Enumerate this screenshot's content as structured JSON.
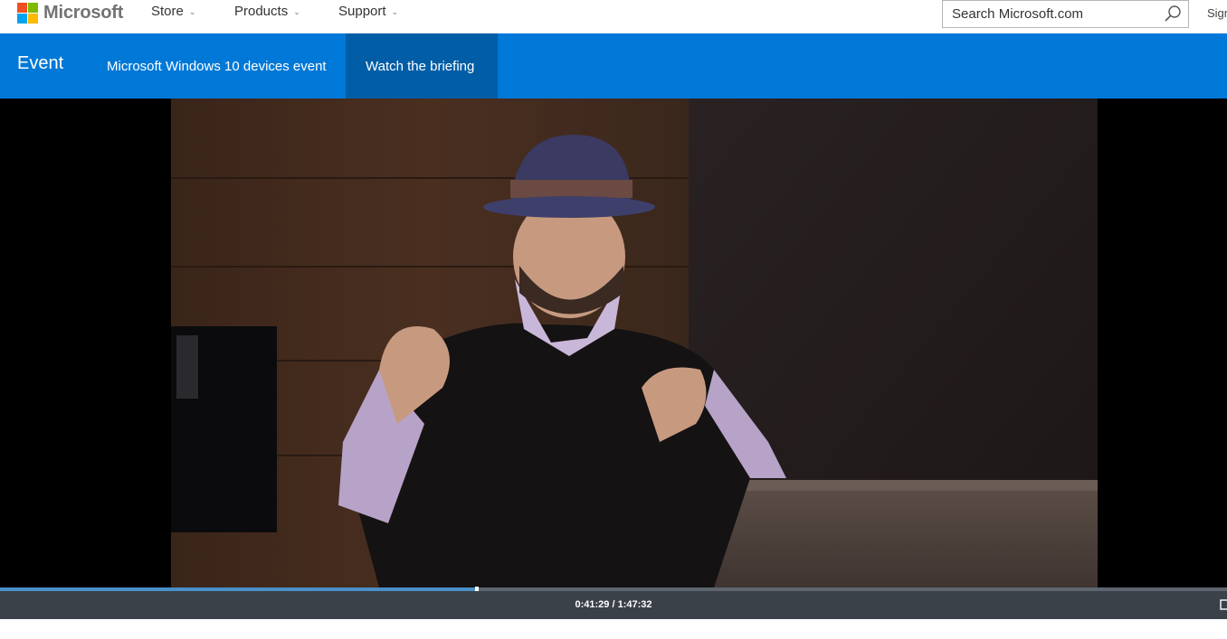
{
  "header": {
    "logo_text": "Microsoft",
    "logo_colors": [
      "#f25022",
      "#7fba00",
      "#00a4ef",
      "#ffb900"
    ],
    "nav": [
      {
        "label": "Store"
      },
      {
        "label": "Products"
      },
      {
        "label": "Support"
      }
    ],
    "search": {
      "placeholder": "Search Microsoft.com"
    },
    "signin_label": "Sign in"
  },
  "event_bar": {
    "title": "Event",
    "tabs": [
      {
        "label": "Microsoft Windows 10 devices event",
        "active": false
      },
      {
        "label": "Watch the briefing",
        "active": true
      }
    ],
    "color": "#0078d7",
    "active_color": "#005da6"
  },
  "video": {
    "progress": 0.389,
    "current_time": "0:41:29",
    "total_time": "1:47:32",
    "time_readout": "0:41:29 / 1:47:32"
  },
  "icons": {
    "search": "search-icon",
    "chevron": "chevron-down-icon",
    "fullscreen": "fullscreen-icon"
  }
}
